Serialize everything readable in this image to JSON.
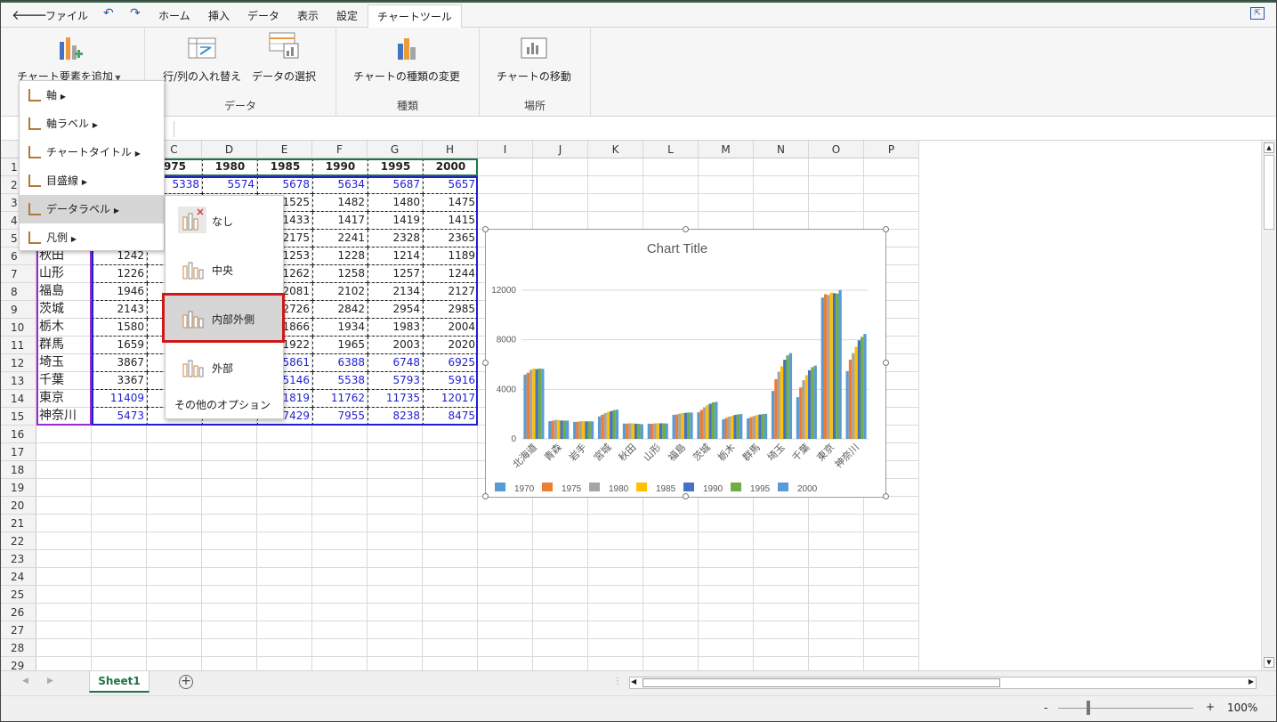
{
  "menubar": {
    "items": [
      "ファイル",
      "ホーム",
      "挿入",
      "データ",
      "表示",
      "設定"
    ],
    "active_tab": "チャートツール"
  },
  "ribbon": {
    "add_element": "チャート要素を追加",
    "swap_rowcol": "行/列の入れ替え",
    "select_data": "データの選択",
    "change_type": "チャートの種類の変更",
    "move_chart": "チャートの移動",
    "groups": {
      "data": "データ",
      "type": "種類",
      "location": "場所"
    }
  },
  "dropdown": {
    "items": [
      "軸",
      "軸ラベル",
      "チャートタイトル",
      "目盛線",
      "データラベル",
      "凡例"
    ]
  },
  "submenu": {
    "items": [
      "なし",
      "中央",
      "内部外側",
      "外部"
    ],
    "more": "その他のオプション"
  },
  "columns": [
    "C",
    "D",
    "E",
    "F",
    "G",
    "H",
    "I",
    "J",
    "K",
    "L",
    "M",
    "N",
    "O",
    "P"
  ],
  "rows": [
    "1",
    "2",
    "3",
    "4",
    "5",
    "6",
    "7",
    "8",
    "9",
    "10",
    "11",
    "12",
    "13",
    "14",
    "15",
    "16",
    "17",
    "18",
    "19",
    "20",
    "21",
    "22",
    "23",
    "24",
    "25",
    "26",
    "27",
    "28",
    "29"
  ],
  "table": {
    "header": [
      "975",
      "1980",
      "1985",
      "1990",
      "1995",
      "2000"
    ],
    "rows": [
      {
        "name": "",
        "b": "",
        "c": "5338",
        "d": "5574",
        "e": "5678",
        "f": "5634",
        "g": "5687",
        "h": "5657"
      },
      {
        "name": "",
        "b": "",
        "c": "",
        "d": "",
        "e": "1525",
        "f": "1482",
        "g": "1480",
        "h": "1475"
      },
      {
        "name": "",
        "b": "",
        "c": "",
        "d": "",
        "e": "1433",
        "f": "1417",
        "g": "1419",
        "h": "1415"
      },
      {
        "name": "",
        "b": "",
        "c": "",
        "d": "",
        "e": "2175",
        "f": "2241",
        "g": "2328",
        "h": "2365"
      },
      {
        "name": "秋田",
        "b": "1242",
        "c": "",
        "d": "",
        "e": "1253",
        "f": "1228",
        "g": "1214",
        "h": "1189"
      },
      {
        "name": "山形",
        "b": "1226",
        "c": "",
        "d": "",
        "e": "1262",
        "f": "1258",
        "g": "1257",
        "h": "1244"
      },
      {
        "name": "福島",
        "b": "1946",
        "c": "",
        "d": "",
        "e": "2081",
        "f": "2102",
        "g": "2134",
        "h": "2127"
      },
      {
        "name": "茨城",
        "b": "2143",
        "c": "",
        "d": "",
        "e": "2726",
        "f": "2842",
        "g": "2954",
        "h": "2985"
      },
      {
        "name": "栃木",
        "b": "1580",
        "c": "",
        "d": "",
        "e": "1866",
        "f": "1934",
        "g": "1983",
        "h": "2004"
      },
      {
        "name": "群馬",
        "b": "1659",
        "c": "",
        "d": "",
        "e": "1922",
        "f": "1965",
        "g": "2003",
        "h": "2020"
      },
      {
        "name": "埼玉",
        "b": "3867",
        "c": "",
        "d": "",
        "e": "5861",
        "f": "6388",
        "g": "6748",
        "h": "6925"
      },
      {
        "name": "千葉",
        "b": "3367",
        "c": "",
        "d": "",
        "e": "5146",
        "f": "5538",
        "g": "5793",
        "h": "5916"
      },
      {
        "name": "東京",
        "b": "11409",
        "c": "",
        "d": "",
        "e": "11819",
        "f": "11762",
        "g": "11735",
        "h": "12017"
      },
      {
        "name": "神奈川",
        "b": "5473",
        "c": "",
        "d": "",
        "e": "7429",
        "f": "7955",
        "g": "8238",
        "h": "8475"
      }
    ]
  },
  "sheet_tab": "Sheet1",
  "zoom": "100%",
  "chart_data": {
    "type": "bar",
    "title": "Chart Title",
    "categories": [
      "北海道",
      "青森",
      "岩手",
      "宮城",
      "秋田",
      "山形",
      "福島",
      "茨城",
      "栃木",
      "群馬",
      "埼玉",
      "千葉",
      "東京",
      "神奈川"
    ],
    "ylim": [
      0,
      12000
    ],
    "yticks": [
      "0",
      "4000",
      "8000",
      "12000"
    ],
    "grid": true,
    "legend": "bottom",
    "series": [
      {
        "name": "1970",
        "color": "#5b9bd5",
        "values": [
          5184,
          1428,
          1371,
          1819,
          1241,
          1226,
          1946,
          2143,
          1580,
          1659,
          3867,
          3367,
          11409,
          5473
        ]
      },
      {
        "name": "1975",
        "color": "#ed7d31",
        "values": [
          5338,
          1469,
          1386,
          1955,
          1232,
          1220,
          1971,
          2342,
          1698,
          1756,
          4821,
          4149,
          11674,
          6398
        ]
      },
      {
        "name": "1980",
        "color": "#a5a5a5",
        "values": [
          5574,
          1524,
          1422,
          2082,
          1257,
          1252,
          2035,
          2558,
          1792,
          1849,
          5420,
          4735,
          11618,
          6924
        ]
      },
      {
        "name": "1985",
        "color": "#ffc000",
        "values": [
          5678,
          1525,
          1433,
          2175,
          1253,
          1262,
          2081,
          2726,
          1866,
          1922,
          5861,
          5146,
          11819,
          7429
        ]
      },
      {
        "name": "1990",
        "color": "#4472c4",
        "values": [
          5634,
          1482,
          1417,
          2241,
          1228,
          1258,
          2102,
          2842,
          1934,
          1965,
          6388,
          5538,
          11762,
          7955
        ]
      },
      {
        "name": "1995",
        "color": "#70ad47",
        "values": [
          5687,
          1480,
          1419,
          2328,
          1214,
          1257,
          2134,
          2954,
          1983,
          2003,
          6748,
          5793,
          11735,
          8238
        ]
      },
      {
        "name": "2000",
        "color": "#5b9bd5",
        "values": [
          5657,
          1475,
          1415,
          2365,
          1189,
          1244,
          2127,
          2985,
          2004,
          2020,
          6925,
          5916,
          12017,
          8475
        ]
      }
    ]
  }
}
